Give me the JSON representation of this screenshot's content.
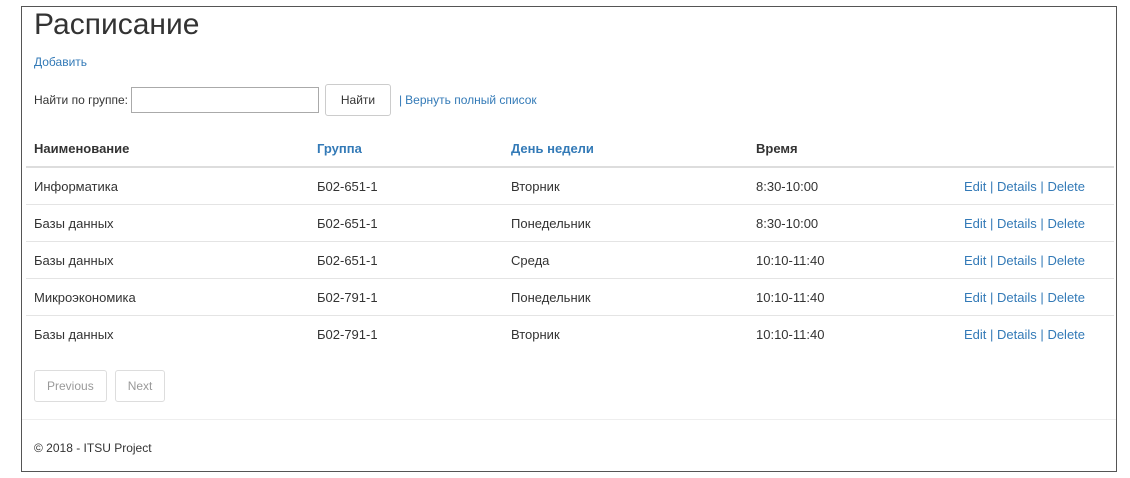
{
  "page": {
    "title": "Расписание",
    "add_label": "Добавить"
  },
  "search": {
    "label": "Найти по группе:",
    "value": "",
    "placeholder": "",
    "button_label": "Найти",
    "separator": "|",
    "reset_label": "Вернуть полный список"
  },
  "table": {
    "headers": {
      "name": "Наименование",
      "group": "Группа",
      "day": "День недели",
      "time": "Время"
    },
    "rows": [
      {
        "name": "Информатика",
        "group": "Б02-651-1",
        "day": "Вторник",
        "time": "8:30-10:00"
      },
      {
        "name": "Базы данных",
        "group": "Б02-651-1",
        "day": "Понедельник",
        "time": "8:30-10:00"
      },
      {
        "name": "Базы данных",
        "group": "Б02-651-1",
        "day": "Среда",
        "time": "10:10-11:40"
      },
      {
        "name": "Микроэкономика",
        "group": "Б02-791-1",
        "day": "Понедельник",
        "time": "10:10-11:40"
      },
      {
        "name": "Базы данных",
        "group": "Б02-791-1",
        "day": "Вторник",
        "time": "10:10-11:40"
      }
    ],
    "actions": {
      "edit": "Edit",
      "details": "Details",
      "delete": "Delete",
      "separator": "|"
    }
  },
  "pager": {
    "previous": "Previous",
    "next": "Next"
  },
  "footer": {
    "text": "© 2018 - ITSU Project"
  },
  "colors": {
    "link": "#337ab7",
    "text": "#333333",
    "border": "#dddddd"
  }
}
